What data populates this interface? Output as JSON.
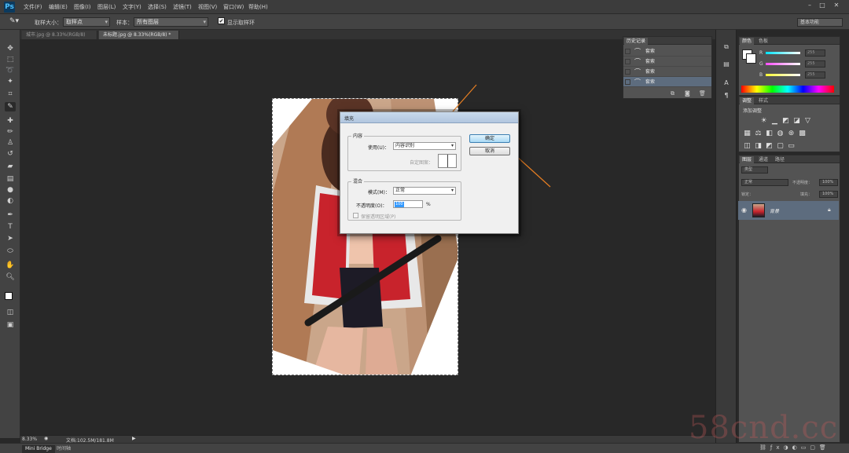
{
  "app": {
    "logo": "Ps"
  },
  "menubar": {
    "items": [
      "文件(F)",
      "编辑(E)",
      "图像(I)",
      "图层(L)",
      "文字(Y)",
      "选择(S)",
      "滤镜(T)",
      "视图(V)",
      "窗口(W)",
      "帮助(H)"
    ],
    "window_controls": [
      "–",
      "□",
      "✕"
    ]
  },
  "options_bar": {
    "sample_size_label": "取样大小：",
    "sample_size_value": "取样点",
    "sample_label": "样本：",
    "sample_value": "所有图层",
    "show_ring_label": "显示取样环",
    "workspace_label": "基本功能"
  },
  "tabs": [
    {
      "label": "城市.jpg @ 8.33%(RGB/8)",
      "active": false
    },
    {
      "label": "未标题.jpg @ 8.33%(RGB/8) *",
      "active": true
    }
  ],
  "toolbar": {
    "tools": [
      "move-tool",
      "marquee-tool",
      "lasso-tool",
      "quick-select-tool",
      "crop-tool",
      "eyedropper-tool",
      "healing-tool",
      "brush-tool",
      "stamp-tool",
      "history-brush-tool",
      "eraser-tool",
      "gradient-tool",
      "blur-tool",
      "dodge-tool",
      "pen-tool",
      "type-tool",
      "path-select-tool",
      "shape-tool",
      "hand-tool",
      "zoom-tool"
    ]
  },
  "status": {
    "zoom": "8.33%",
    "doc_size": "文档:102.5M/181.8M"
  },
  "bottom_tabs": [
    "Mini Bridge",
    "时间轴"
  ],
  "history_panel": {
    "tab": "历史记录",
    "items": [
      "套索",
      "套索",
      "套索",
      "套索"
    ],
    "selected_index": 3
  },
  "color_panel": {
    "tabs": [
      "颜色",
      "色板"
    ],
    "channels": [
      {
        "name": "R",
        "value": "255"
      },
      {
        "name": "G",
        "value": "255"
      },
      {
        "name": "B",
        "value": "255"
      }
    ],
    "colors": {
      "r": "#00e5ff",
      "g": "#ff4dff",
      "b": "#ffff33"
    }
  },
  "adjustments_panel": {
    "tabs": [
      "调整",
      "样式"
    ],
    "title": "添加调整"
  },
  "layers_panel": {
    "tabs": [
      "图层",
      "通道",
      "路径"
    ],
    "kind_filter": "类型",
    "blend_mode": "正常",
    "opacity_label": "不透明度：",
    "opacity_value": "100%",
    "lock_label": "锁定：",
    "fill_label": "填充：",
    "fill_value": "100%",
    "layers": [
      {
        "name": "背景",
        "selected": true
      }
    ]
  },
  "fill_dialog": {
    "title": "填充",
    "content_group": "内容",
    "use_label": "使用(U)：",
    "use_value": "内容识别",
    "custom_pattern_label": "自定图案：",
    "blending_group": "混合",
    "mode_label": "模式(M)：",
    "mode_value": "正常",
    "opacity_label": "不透明度(O)：",
    "opacity_value": "100",
    "percent": "%",
    "preserve_transparency_label": "保留透明区域(P)",
    "ok_label": "确定",
    "cancel_label": "取消"
  },
  "watermark": "58cnd.cc",
  "annotation_color": "#e67e22"
}
